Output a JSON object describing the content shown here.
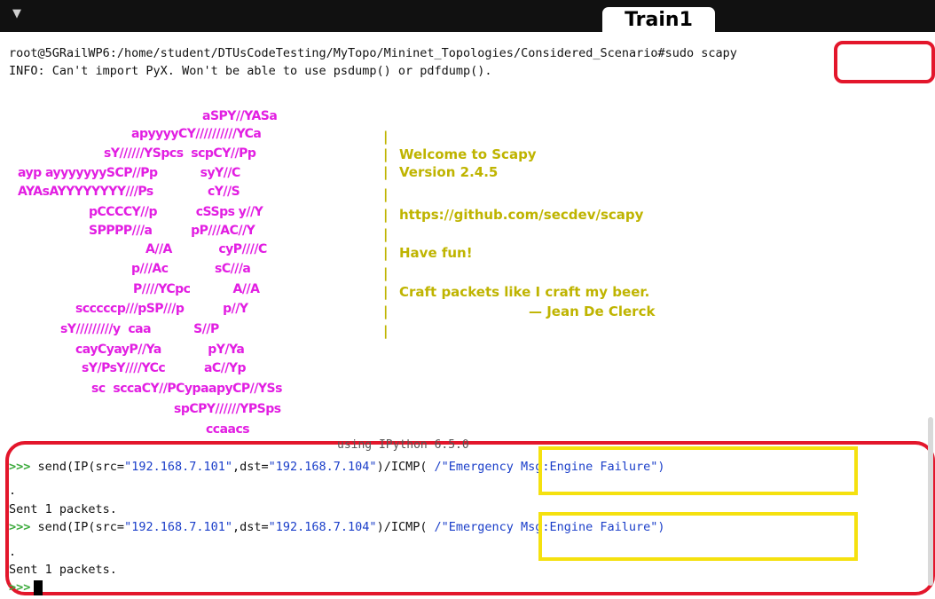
{
  "window": {
    "tab_title": "Train1"
  },
  "terminal": {
    "prompt_path": "root@5GRailWP6:/home/student/DTUsCodeTesting/MyTopo/Mininet_Topologies/Considered_Scenario#",
    "command": "sudo scapy",
    "info_line": "INFO: Can't import PyX. Won't be able to use psdump() or pdfdump().",
    "using_line": "using IPython 6.5.0"
  },
  "banner": {
    "art_lines": [
      "aSPY//YASa",
      "apyyyyCY//////////YCa",
      "sY//////YSpcs  scpCY//Pp",
      "ayp ayyyyyyySCP//Pp           syY//C",
      "AYAsAYYYYYYYY///Ps              cY//S",
      "pCCCCY//p          cSSps y//Y",
      "SPPPP///a          pP///AC//Y",
      "A//A            cyP////C",
      "p///Ac            sC///a",
      "P////YCpc           A//A",
      "scccccp///pSP///p          p//Y",
      "sY/////////y  caa           S//P",
      "cayCyayP//Ya            pY/Ya",
      "sY/PsY////YCc          aC//Yp",
      "sc  sccaCY//PCypaapyCP//YSs",
      "spCPY//////YPSps",
      "ccaacs"
    ],
    "welcome": "Welcome to Scapy",
    "version": "Version 2.4.5",
    "url": "https://github.com/secdev/scapy",
    "have_fun": "Have fun!",
    "quote": "Craft packets like I craft my beer.",
    "quote_author": "— Jean De Clerck",
    "separator": "|"
  },
  "session": {
    "prompt_symbol": ">>>",
    "entries": [
      {
        "cmd_prefix": "send(IP(src=",
        "src": "\"192.168.7.101\"",
        "mid": ",dst=",
        "dst": "\"192.168.7.104\"",
        "after": ")/ICMP(",
        "payload": "/\"Emergency Msg:Engine Failure\")",
        "dot": ".",
        "result": "Sent 1 packets."
      },
      {
        "cmd_prefix": "send(IP(src=",
        "src": "\"192.168.7.101\"",
        "mid": ",dst=",
        "dst": "\"192.168.7.104\"",
        "after": ")/ICMP(",
        "payload": "/\"Emergency Msg:Engine Failure\")",
        "dot": ".",
        "result": "Sent 1 packets."
      }
    ]
  },
  "colors": {
    "highlight_red": "#e3162b",
    "highlight_yellow": "#f5e10f",
    "art_magenta": "#e21ee2",
    "info_olive": "#bfb400",
    "string_blue": "#1a3ec9",
    "prompt_green": "#3caa3c"
  }
}
